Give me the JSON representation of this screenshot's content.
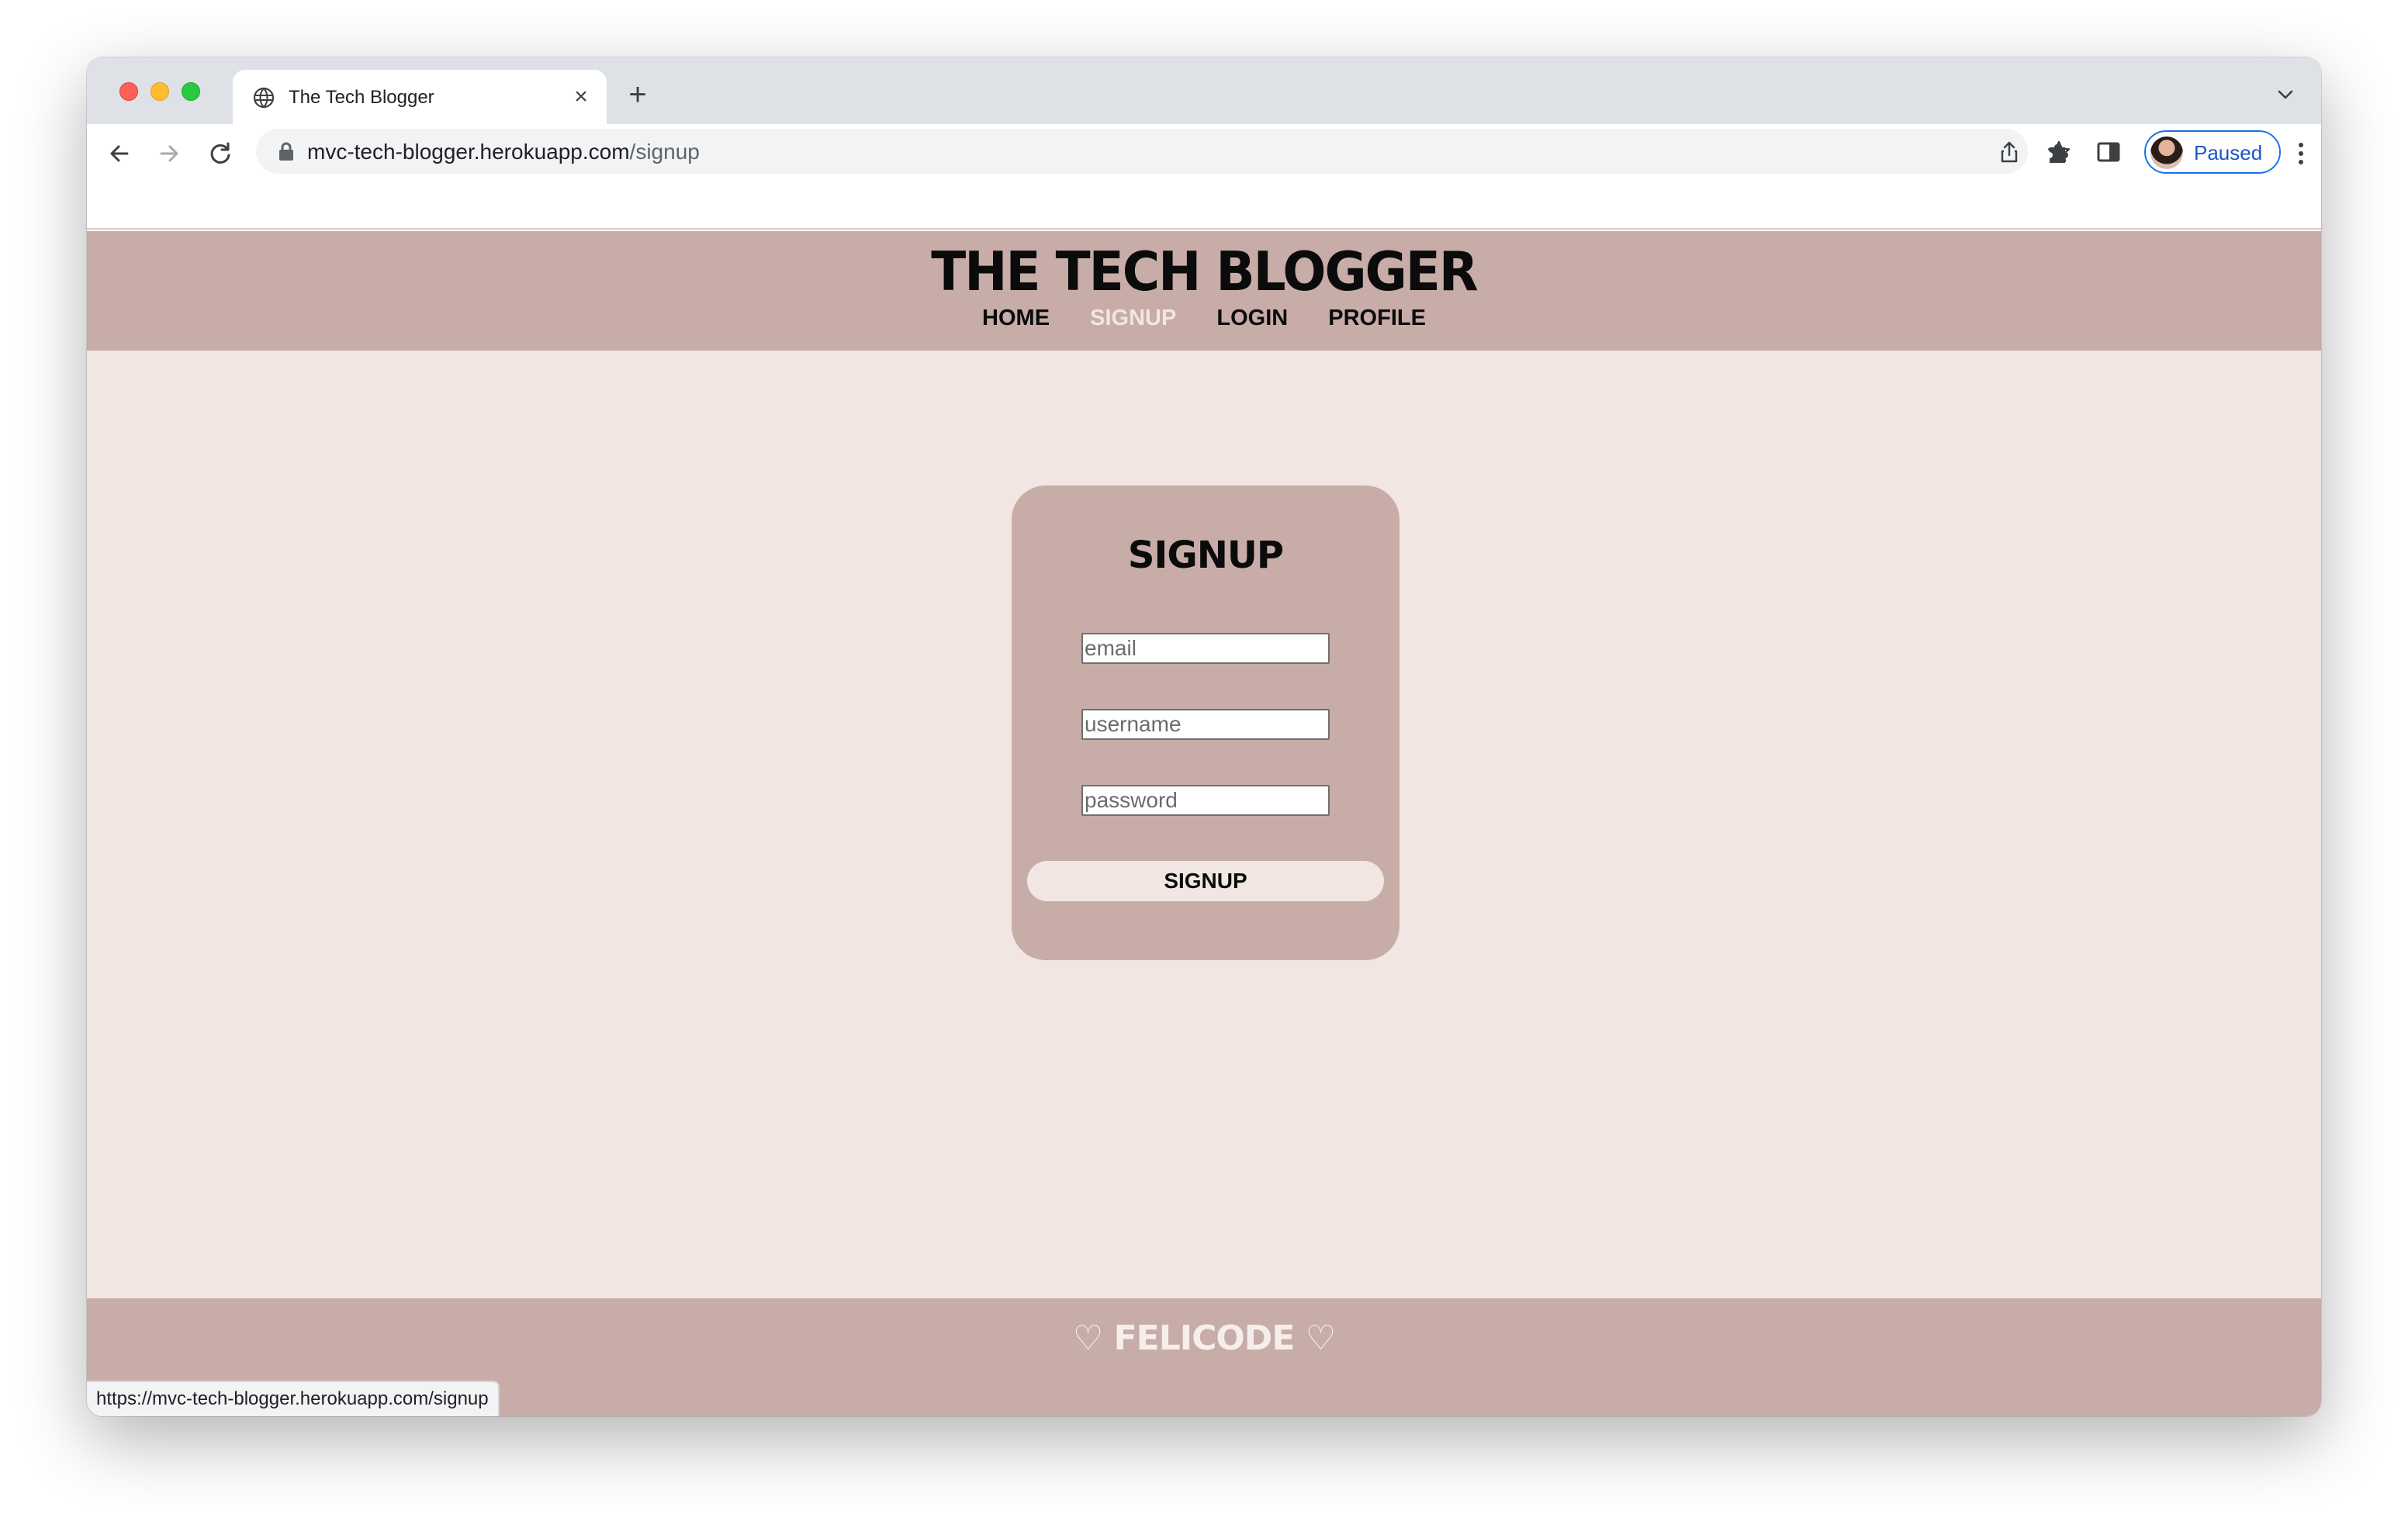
{
  "browser": {
    "tab_title": "The Tech Blogger",
    "url_host": "mvc-tech-blogger.herokuapp.com",
    "url_path": "/signup",
    "profile_status": "Paused",
    "status_bar_url": "https://mvc-tech-blogger.herokuapp.com/signup"
  },
  "site": {
    "title": "The Tech Blogger",
    "nav": [
      {
        "label": "HOME"
      },
      {
        "label": "SIGNUP"
      },
      {
        "label": "LOGIN"
      },
      {
        "label": "PROFILE"
      }
    ],
    "active_nav": "SIGNUP"
  },
  "signup_form": {
    "heading": "SIGNUP",
    "email_placeholder": "email",
    "username_placeholder": "username",
    "password_placeholder": "password",
    "submit_label": "SIGNUP"
  },
  "footer": {
    "text": "♡ FELICODE ♡"
  },
  "colors": {
    "header_bg": "#c8aca8",
    "page_bg": "#f1e6e2",
    "active_nav": "#f1e6e2",
    "text": "#0b0b0b"
  }
}
